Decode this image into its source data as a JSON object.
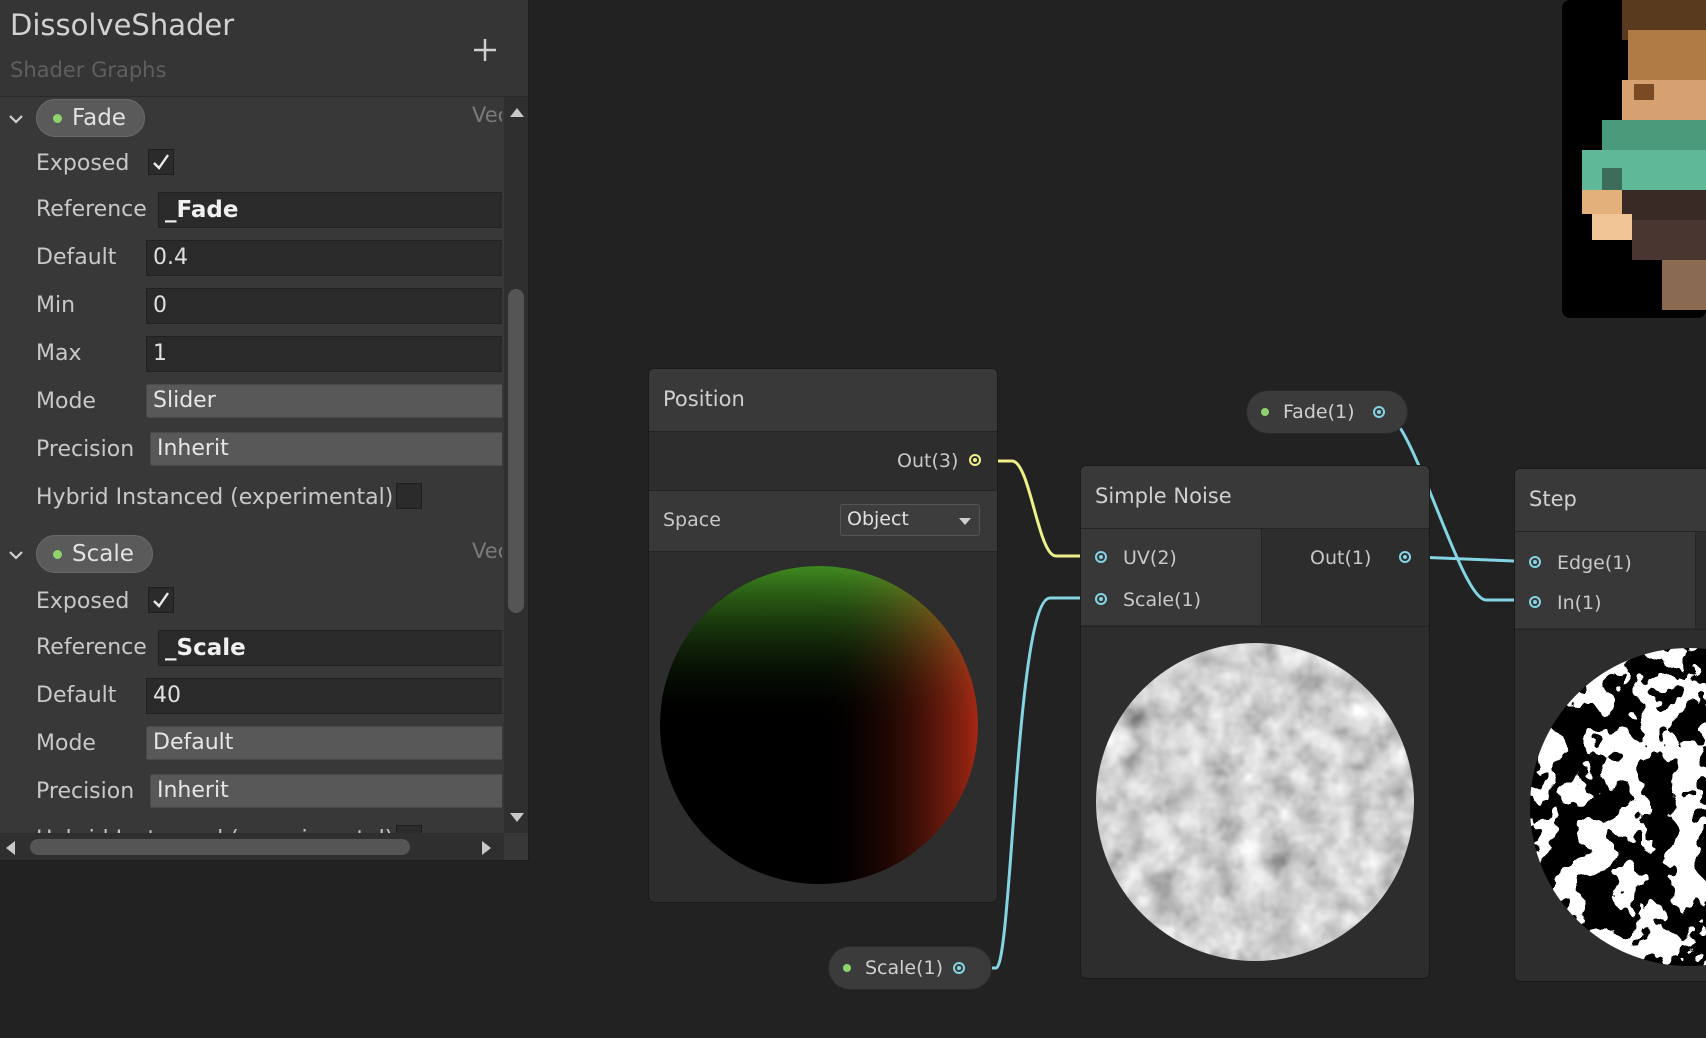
{
  "blackboard": {
    "title": "DissolveShader",
    "subtitle": "Shader Graphs",
    "properties": [
      {
        "name": "Fade",
        "type": "Vec",
        "exposed": true,
        "labels": {
          "exposed": "Exposed",
          "reference": "Reference",
          "default": "Default",
          "min": "Min",
          "max": "Max",
          "mode": "Mode",
          "precision": "Precision",
          "hybrid": "Hybrid Instanced (experimental)"
        },
        "reference": "_Fade",
        "default": "0.4",
        "min": "0",
        "max": "1",
        "mode": "Slider",
        "precision": "Inherit",
        "hybrid_instanced": false
      },
      {
        "name": "Scale",
        "type": "Vec",
        "exposed": true,
        "labels": {
          "exposed": "Exposed",
          "reference": "Reference",
          "default": "Default",
          "mode": "Mode",
          "precision": "Precision"
        },
        "reference": "_Scale",
        "default": "40",
        "mode": "Default",
        "precision": "Inherit"
      }
    ]
  },
  "graph": {
    "position_node": {
      "title": "Position",
      "output": "Out(3)",
      "space_label": "Space",
      "space_value": "Object"
    },
    "noise_node": {
      "title": "Simple Noise",
      "inputs": [
        "UV(2)",
        "Scale(1)"
      ],
      "output": "Out(1)"
    },
    "step_node": {
      "title": "Step",
      "inputs": [
        "Edge(1)",
        "In(1)"
      ]
    },
    "fade_property_node": {
      "label": "Fade(1)"
    },
    "scale_property_node": {
      "label": "Scale(1)"
    }
  },
  "colors": {
    "vector3_wire": "#f0f08a",
    "vector1_wire": "#84d4e4",
    "property_dot": "#8fd36a",
    "background": "#222222"
  }
}
